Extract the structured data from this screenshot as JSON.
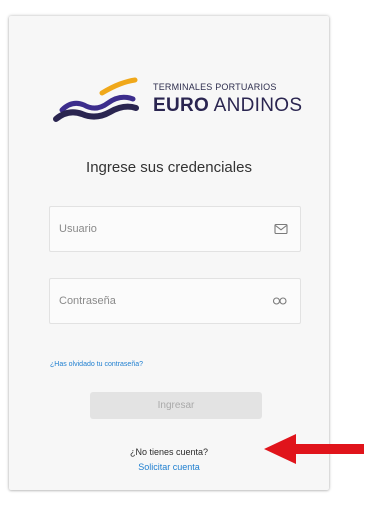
{
  "brand": {
    "tagline": "TERMINALES PORTUARIOS",
    "name_bold": "EURO",
    "name_rest": "ANDINOS",
    "colors": {
      "navy": "#2a2550",
      "purple": "#3c2d8c",
      "gold": "#f0a81a"
    }
  },
  "form": {
    "heading": "Ingrese sus credenciales",
    "username": {
      "placeholder": "Usuario",
      "value": "",
      "icon": "mail-icon"
    },
    "password": {
      "placeholder": "Contraseña",
      "value": "",
      "icon": "key-icon"
    },
    "forgot_link": "¿Has olvidado tu contraseña?",
    "submit_label": "Ingresar"
  },
  "signup": {
    "prompt": "¿No tienes cuenta?",
    "link": "Solicitar cuenta"
  },
  "annotation": {
    "arrow_color": "#e0141b",
    "icon": "arrow-left-icon"
  }
}
